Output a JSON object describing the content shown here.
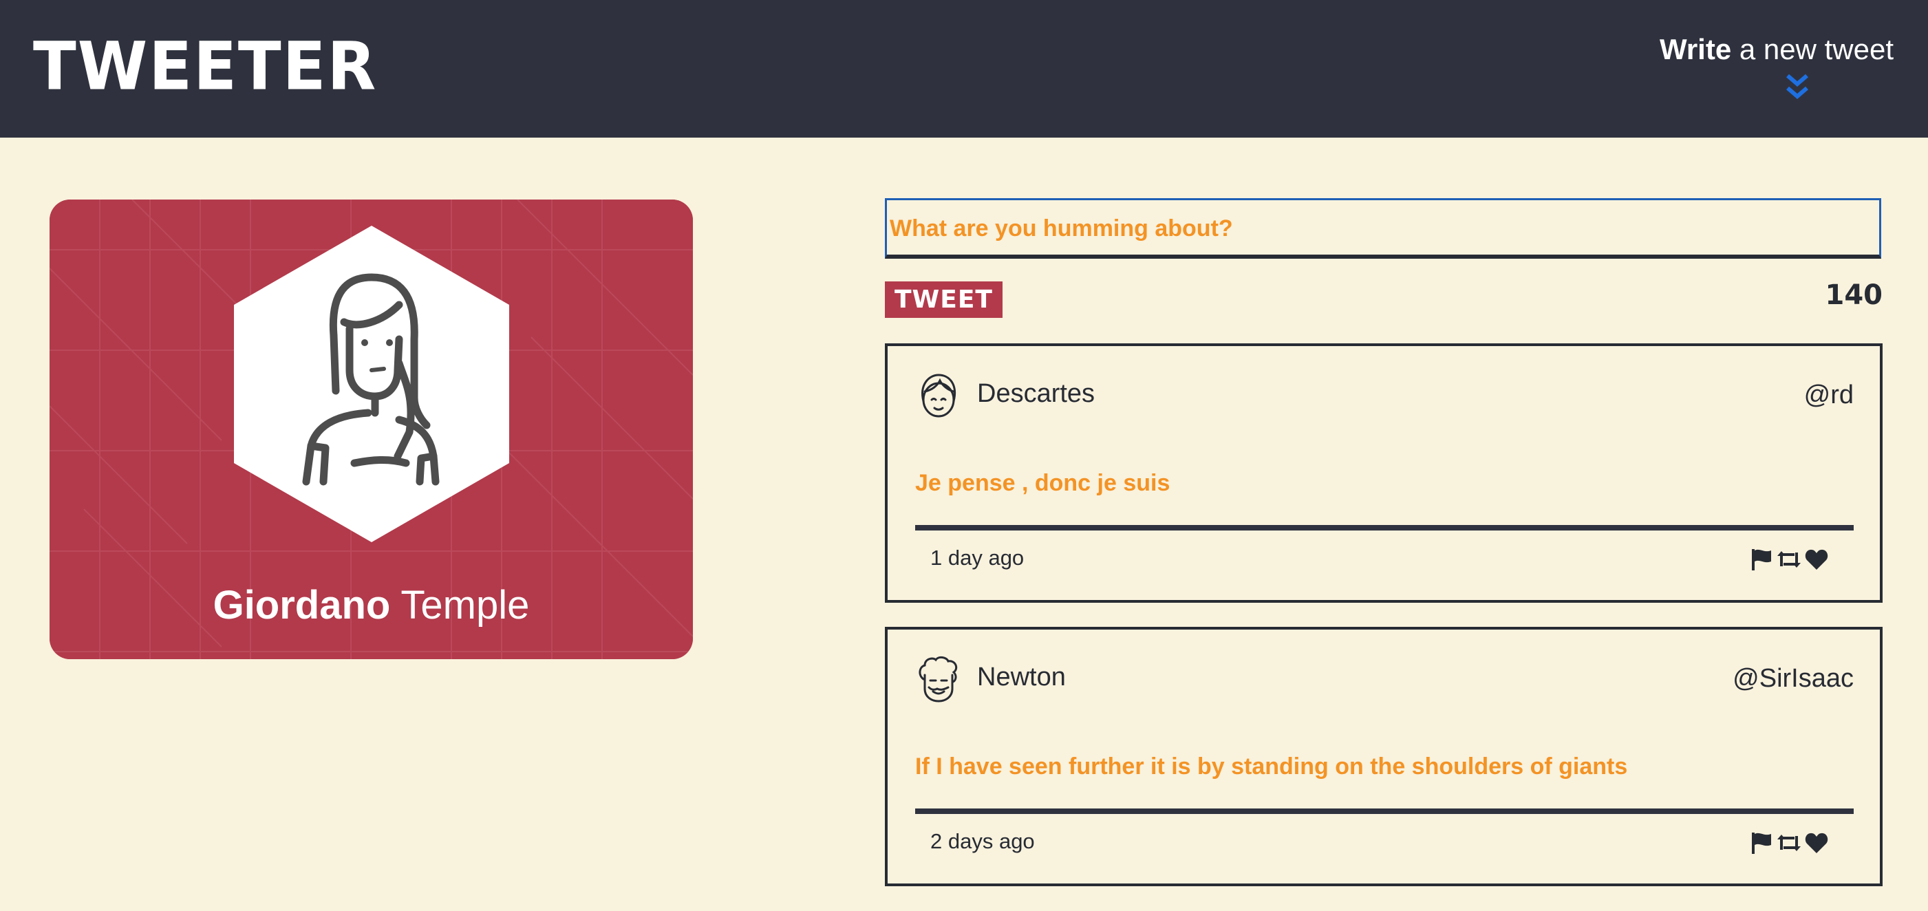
{
  "nav": {
    "logo": "TWEETER",
    "compose_bold": "Write",
    "compose_rest": " a new tweet",
    "compose_icon": "double-chevron-down-icon",
    "background": "#2f323e",
    "accent": "#1e6fe0"
  },
  "profile": {
    "first_name": "Giordano",
    "last_name": " Temple",
    "avatar_icon": "woman-avatar-icon",
    "card_color": "#b23a4b"
  },
  "composer": {
    "placeholder": "What are you humming about?",
    "button_label": "TWEET",
    "counter": "140"
  },
  "tweets": [
    {
      "author": "Descartes",
      "handle": "@rd",
      "content": "Je pense , donc je suis",
      "time": "1 day ago",
      "avatar_icon": "girl-face-avatar-icon",
      "actions": [
        "flag-icon",
        "retweet-icon",
        "heart-icon"
      ]
    },
    {
      "author": "Newton",
      "handle": "@SirIsaac",
      "content": "If I have seen further it is by standing on the shoulders of giants",
      "time": "2 days ago",
      "avatar_icon": "curly-hair-face-avatar-icon",
      "actions": [
        "flag-icon",
        "retweet-icon",
        "heart-icon"
      ]
    }
  ],
  "colors": {
    "page_bg": "#f9f2dd",
    "highlight_text": "#f39325",
    "dark": "#272b33"
  }
}
